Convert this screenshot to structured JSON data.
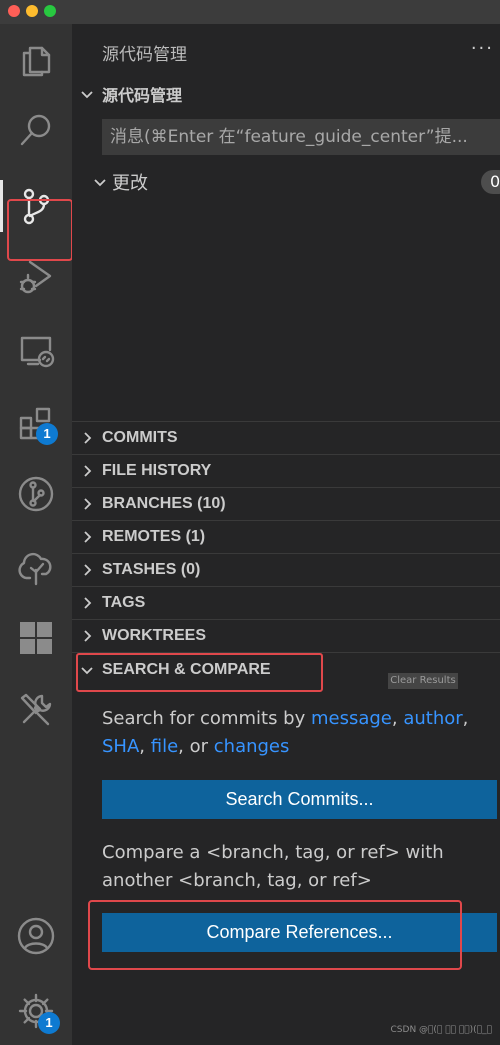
{
  "activity_bar": {
    "items": [
      {
        "id": "explorer",
        "icon": "files-icon"
      },
      {
        "id": "search",
        "icon": "search-icon"
      },
      {
        "id": "source-control",
        "icon": "source-control-icon",
        "active": true
      },
      {
        "id": "run-debug",
        "icon": "run-debug-icon"
      },
      {
        "id": "remote-explorer",
        "icon": "remote-explorer-icon"
      },
      {
        "id": "extensions",
        "icon": "extensions-icon",
        "badge": "1"
      },
      {
        "id": "gitlens",
        "icon": "gitlens-icon"
      },
      {
        "id": "gitlens-inspect",
        "icon": "tree-icon"
      },
      {
        "id": "grid",
        "icon": "grid-icon"
      },
      {
        "id": "tools",
        "icon": "tools-icon"
      }
    ],
    "bottom": [
      {
        "id": "accounts",
        "icon": "account-icon"
      },
      {
        "id": "manage",
        "icon": "gear-icon",
        "badge": "1"
      }
    ]
  },
  "sidebar": {
    "view_title": "源代码管理",
    "more": "···",
    "scm_section_title": "源代码管理",
    "commit_message_placeholder": "消息(⌘Enter 在“feature_guide_center”提...",
    "changes_label": "更改",
    "changes_count": "0",
    "sections": [
      {
        "label": "COMMITS"
      },
      {
        "label": "FILE HISTORY"
      },
      {
        "label": "BRANCHES (10)"
      },
      {
        "label": "REMOTES (1)"
      },
      {
        "label": "STASHES (0)"
      },
      {
        "label": "TAGS"
      },
      {
        "label": "WORKTREES"
      }
    ],
    "search_compare": {
      "title": "SEARCH & COMPARE",
      "clear_results": "Clear Results",
      "search_text_prefix": "Search for commits by ",
      "links": {
        "message": "message",
        "author": "author",
        "sha": "SHA",
        "file": "file",
        "changes": "changes"
      },
      "comma": ",",
      "or": ", or",
      "search_button": "Search Commits...",
      "compare_text": "Compare a <branch, tag, or ref> with another <branch, tag, or ref>",
      "compare_button": "Compare References..."
    }
  },
  "watermark": "CSDN @\u0000(\u0000 \u0000\u0000 \u0000\u0000)(\u0000_\u0000",
  "colors": {
    "accent": "#0e639c",
    "link": "#3794ff",
    "highlight": "#e0484b",
    "badge": "#0e7ad1"
  }
}
